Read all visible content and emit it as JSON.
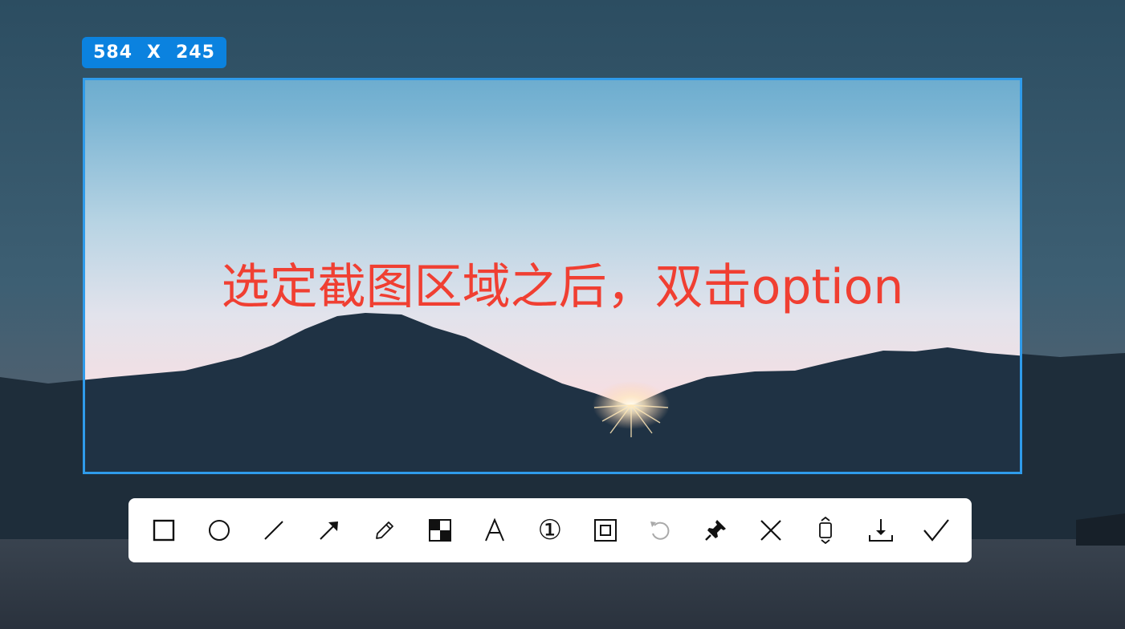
{
  "selection": {
    "width_value": "584",
    "separator": "X",
    "height_value": "245"
  },
  "caption": "选定截图区域之后，双击option",
  "colors": {
    "selection_border": "#2f9bea",
    "badge_bg": "#0b82df",
    "caption_text": "#f03f32",
    "toolbar_bg": "#ffffff"
  },
  "toolbar": {
    "tools": [
      {
        "name": "rectangle-tool",
        "icon": "square-icon",
        "enabled": true
      },
      {
        "name": "ellipse-tool",
        "icon": "circle-icon",
        "enabled": true
      },
      {
        "name": "line-tool",
        "icon": "line-icon",
        "enabled": true
      },
      {
        "name": "arrow-tool",
        "icon": "arrow-icon",
        "enabled": true
      },
      {
        "name": "pen-tool",
        "icon": "pencil-icon",
        "enabled": true
      },
      {
        "name": "mosaic-tool",
        "icon": "mosaic-icon",
        "enabled": true
      },
      {
        "name": "text-tool",
        "icon": "text-icon",
        "enabled": true
      },
      {
        "name": "number-tool",
        "icon": "numbered-marker-icon",
        "enabled": true
      },
      {
        "name": "scroll-capture-tool",
        "icon": "frame-icon",
        "enabled": true
      },
      {
        "name": "undo-button",
        "icon": "undo-icon",
        "enabled": false
      },
      {
        "name": "pin-button",
        "icon": "pin-icon",
        "enabled": true
      },
      {
        "name": "cancel-button",
        "icon": "close-icon",
        "enabled": true
      },
      {
        "name": "long-screenshot-button",
        "icon": "scroll-icon",
        "enabled": true
      },
      {
        "name": "save-button",
        "icon": "download-icon",
        "enabled": true
      },
      {
        "name": "confirm-button",
        "icon": "check-icon",
        "enabled": true
      }
    ],
    "number_glyph": "①"
  }
}
